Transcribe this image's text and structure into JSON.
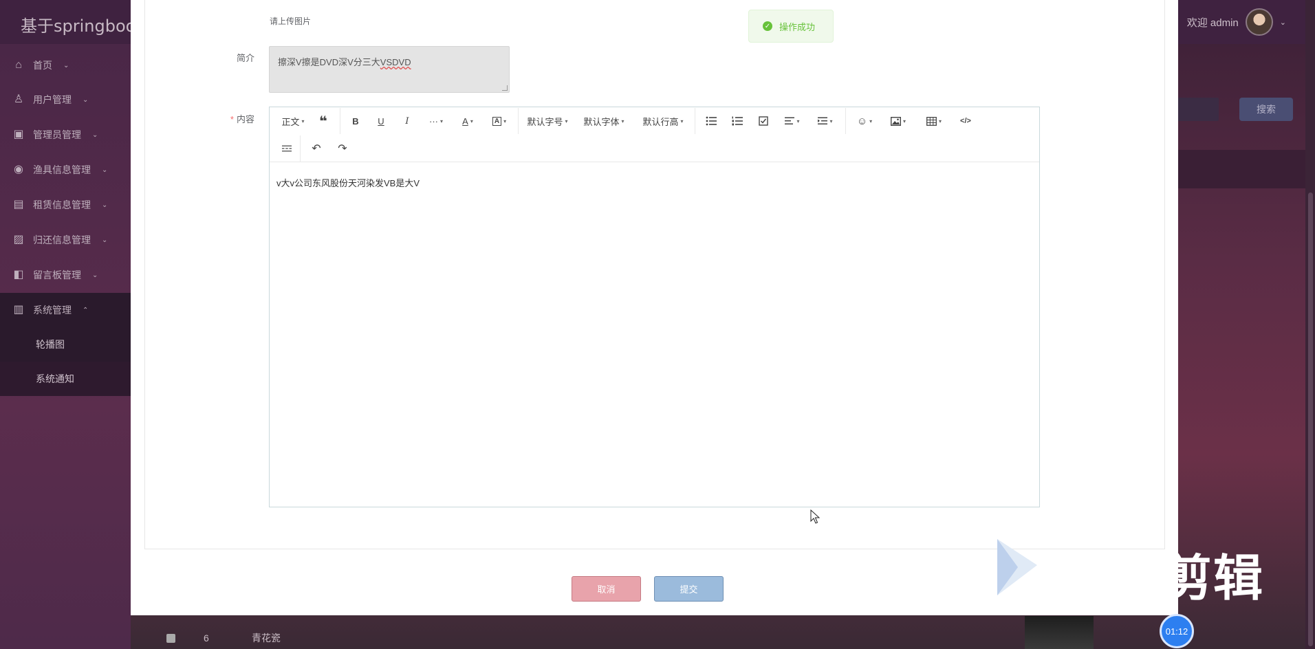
{
  "app": {
    "brand": "基于springboot",
    "welcome": "欢迎 admin"
  },
  "sidebar": {
    "items": [
      {
        "label": "首页",
        "icon": "home-icon"
      },
      {
        "label": "用户管理",
        "icon": "user-icon"
      },
      {
        "label": "管理员管理",
        "icon": "image-icon"
      },
      {
        "label": "渔具信息管理",
        "icon": "compass-icon"
      },
      {
        "label": "租赁信息管理",
        "icon": "gift-icon"
      },
      {
        "label": "归还信息管理",
        "icon": "chart-icon"
      },
      {
        "label": "留言板管理",
        "icon": "panel-icon"
      },
      {
        "label": "系统管理",
        "icon": "book-icon"
      }
    ],
    "subitems": [
      {
        "label": "轮播图"
      },
      {
        "label": "系统通知"
      }
    ]
  },
  "background": {
    "search_button": "搜索",
    "row": {
      "number": "6",
      "name": "青花瓷"
    }
  },
  "form": {
    "upload_hint": "请上传图片",
    "intro_label": "简介",
    "intro_value_plain": "擦深V擦是DVD深V分三大",
    "intro_value_underlined": "VSDVD",
    "content_label": "内容",
    "required_mark": "*",
    "content_value": "v大v公司东风股份天河染发VB是大V"
  },
  "toolbar": {
    "paragraph": "正文",
    "font_size": "默认字号",
    "font_family": "默认字体",
    "line_height": "默认行高",
    "more": "···"
  },
  "toast": {
    "message": "操作成功"
  },
  "buttons": {
    "cancel": "取消",
    "submit": "提交"
  },
  "overlay": {
    "watermark_text": "剪辑",
    "timer": "01:12"
  },
  "colors": {
    "success": "#67c23a",
    "cancel_bg": "#e8a3ab",
    "submit_bg": "#9bbbdc",
    "timer_bg": "#2d7ff0"
  }
}
